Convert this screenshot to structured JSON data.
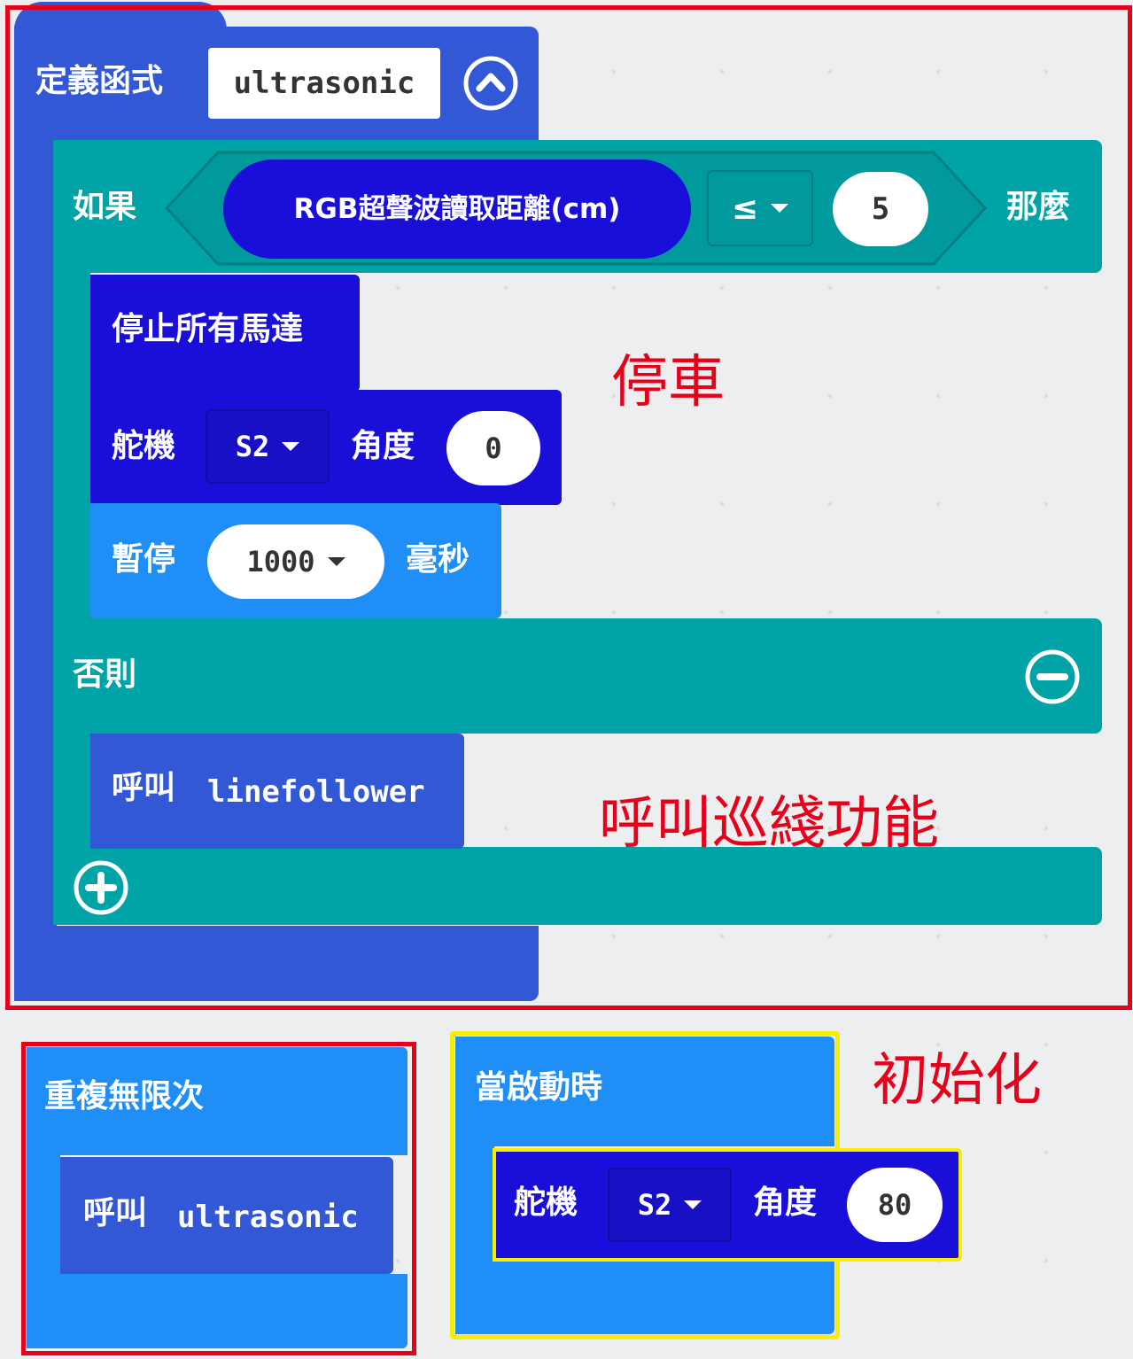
{
  "function_block": {
    "label": "定義函式",
    "name": "ultrasonic",
    "if_block": {
      "if_label": "如果",
      "sensor_label": "RGB超聲波讀取距離(cm)",
      "operator": "≤",
      "value": "5",
      "then_label": "那麼",
      "stop_label": "停止所有馬達",
      "servo_label": "舵機",
      "servo_port": "S2",
      "angle_label": "角度",
      "angle_value": "0",
      "pause_label": "暫停",
      "pause_value": "1000",
      "ms_label": "毫秒",
      "else_label": "否則",
      "call_label": "呼叫",
      "call_name": "linefollower"
    }
  },
  "forever_block": {
    "label": "重複無限次",
    "call_label": "呼叫",
    "call_name": "ultrasonic"
  },
  "start_block": {
    "label": "當啟動時",
    "servo_label": "舵機",
    "servo_port": "S2",
    "angle_label": "角度",
    "angle_value": "80"
  },
  "annotations": {
    "stop_car": "停車",
    "call_linefollow": "呼叫巡綫功能",
    "init": "初始化"
  },
  "colors": {
    "function": "#3358d6",
    "logic": "#00a4a6",
    "motor": "#1a0fd8",
    "basic": "#1f8ff7",
    "annotation": "#e6001a",
    "highlight": "#f5ee00"
  }
}
